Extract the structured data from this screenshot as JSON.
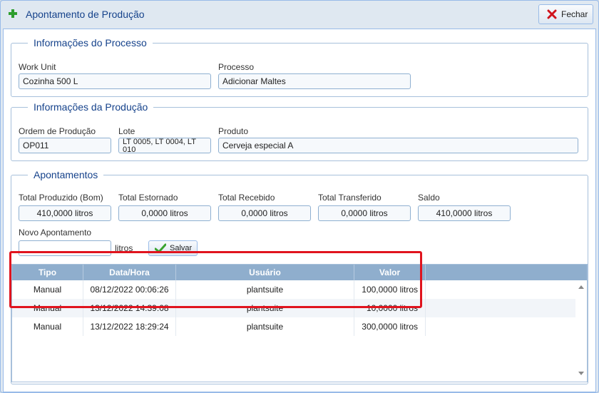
{
  "dialog": {
    "title": "Apontamento de Produção",
    "close_label": "Fechar"
  },
  "processo": {
    "legend": "Informações do Processo",
    "work_unit_label": "Work Unit",
    "work_unit_value": "Cozinha 500 L",
    "processo_label": "Processo",
    "processo_value": "Adicionar Maltes"
  },
  "producao": {
    "legend": "Informações da Produção",
    "ordem_label": "Ordem de Produção",
    "ordem_value": "OP011",
    "lote_label": "Lote",
    "lote_value": "LT 0005, LT 0004, LT 010",
    "produto_label": "Produto",
    "produto_value": "Cerveja especial A"
  },
  "apontamentos": {
    "legend": "Apontamentos",
    "total_produzido_label": "Total Produzido (Bom)",
    "total_produzido_value": "410,0000 litros",
    "total_estornado_label": "Total Estornado",
    "total_estornado_value": "0,0000 litros",
    "total_recebido_label": "Total Recebido",
    "total_recebido_value": "0,0000 litros",
    "total_transferido_label": "Total Transferido",
    "total_transferido_value": "0,0000 litros",
    "saldo_label": "Saldo",
    "saldo_value": "410,0000 litros",
    "novo_label": "Novo Apontamento",
    "novo_value": "",
    "unit": "litros",
    "save_label": "Salvar"
  },
  "grid": {
    "columns": [
      "Tipo",
      "Data/Hora",
      "Usuário",
      "Valor"
    ],
    "rows": [
      {
        "tipo": "Manual",
        "data": "08/12/2022 00:06:26",
        "usuario": "plantsuite",
        "valor": "100,0000 litros"
      },
      {
        "tipo": "Manual",
        "data": "13/12/2022 14:39:08",
        "usuario": "plantsuite",
        "valor": "10,0000 litros"
      },
      {
        "tipo": "Manual",
        "data": "13/12/2022 18:29:24",
        "usuario": "plantsuite",
        "valor": "300,0000 litros"
      }
    ]
  },
  "colors": {
    "accent": "#15428b",
    "header": "#8faecd",
    "highlight": "#e0141e"
  }
}
